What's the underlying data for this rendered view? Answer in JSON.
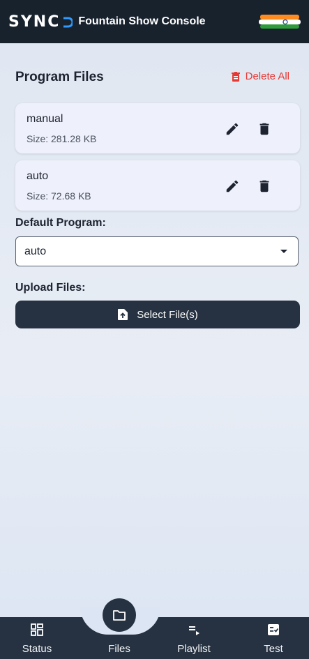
{
  "header": {
    "logo_text": "SYNC",
    "title": "Fountain Show Console",
    "logo_icon": "sync-logo-icon",
    "flag_icon": "india-flag-icon"
  },
  "files": {
    "section_title": "Program Files",
    "delete_all_label": "Delete All",
    "items": [
      {
        "name": "manual",
        "size": "Size: 281.28 KB"
      },
      {
        "name": "auto",
        "size": "Size: 72.68 KB"
      }
    ]
  },
  "default_program": {
    "label": "Default Program:",
    "selected": "auto"
  },
  "upload": {
    "label": "Upload Files:",
    "button_label": "Select File(s)"
  },
  "nav": {
    "items": [
      {
        "label": "Status",
        "icon": "dashboard-icon"
      },
      {
        "label": "Files",
        "icon": "folder-icon",
        "active": true
      },
      {
        "label": "Playlist",
        "icon": "playlist-icon"
      },
      {
        "label": "Test",
        "icon": "checklist-icon"
      }
    ]
  },
  "colors": {
    "header_bg": "#18222d",
    "danger": "#e53935",
    "nav_bg": "#263241"
  }
}
